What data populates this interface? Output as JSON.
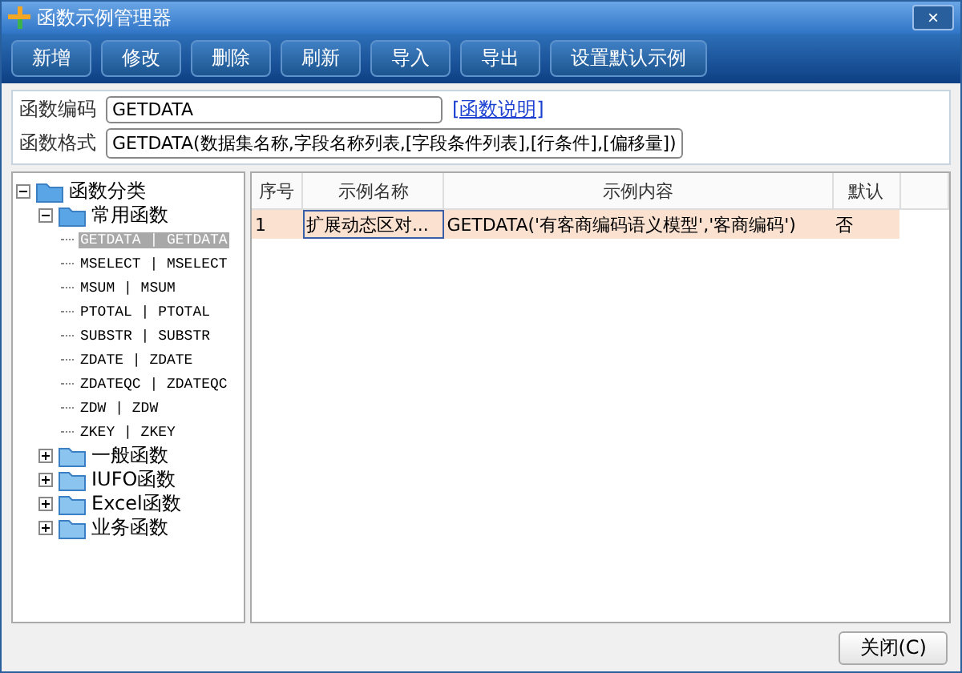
{
  "window": {
    "title": "函数示例管理器",
    "close": "×"
  },
  "toolbar": [
    "新增",
    "修改",
    "删除",
    "刷新",
    "导入",
    "导出",
    "设置默认示例"
  ],
  "form": {
    "code_label": "函数编码",
    "code_value": "GETDATA",
    "help_link": "[函数说明]",
    "format_label": "函数格式",
    "format_value": "GETDATA(数据集名称,字段名称列表,[字段条件列表],[行条件],[偏移量])"
  },
  "tree": [
    {
      "label": "函数分类",
      "expanded": true,
      "children": [
        {
          "label": "常用函数",
          "expanded": true,
          "children": [
            {
              "label": "GETDATA | GETDATA",
              "selected": true
            },
            {
              "label": "MSELECT | MSELECT",
              "selected": false
            },
            {
              "label": "MSUM | MSUM",
              "selected": false
            },
            {
              "label": "PTOTAL | PTOTAL",
              "selected": false
            },
            {
              "label": "SUBSTR | SUBSTR",
              "selected": false
            },
            {
              "label": "ZDATE | ZDATE",
              "selected": false
            },
            {
              "label": "ZDATEQC | ZDATEQC",
              "selected": false
            },
            {
              "label": "ZDW | ZDW",
              "selected": false
            },
            {
              "label": "ZKEY | ZKEY",
              "selected": false
            }
          ]
        },
        {
          "label": "一般函数",
          "expanded": false
        },
        {
          "label": "IUFO函数",
          "expanded": false
        },
        {
          "label": "Excel函数",
          "expanded": false
        },
        {
          "label": "业务函数",
          "expanded": false
        }
      ]
    }
  ],
  "table": {
    "columns": [
      "序号",
      "示例名称",
      "示例内容",
      "默认"
    ],
    "rows": [
      {
        "selected": true,
        "cells": [
          "1",
          "扩展动态区对...",
          "GETDATA('有客商编码语义模型','客商编码')",
          "否"
        ]
      }
    ]
  },
  "close_button": "关闭(C)"
}
